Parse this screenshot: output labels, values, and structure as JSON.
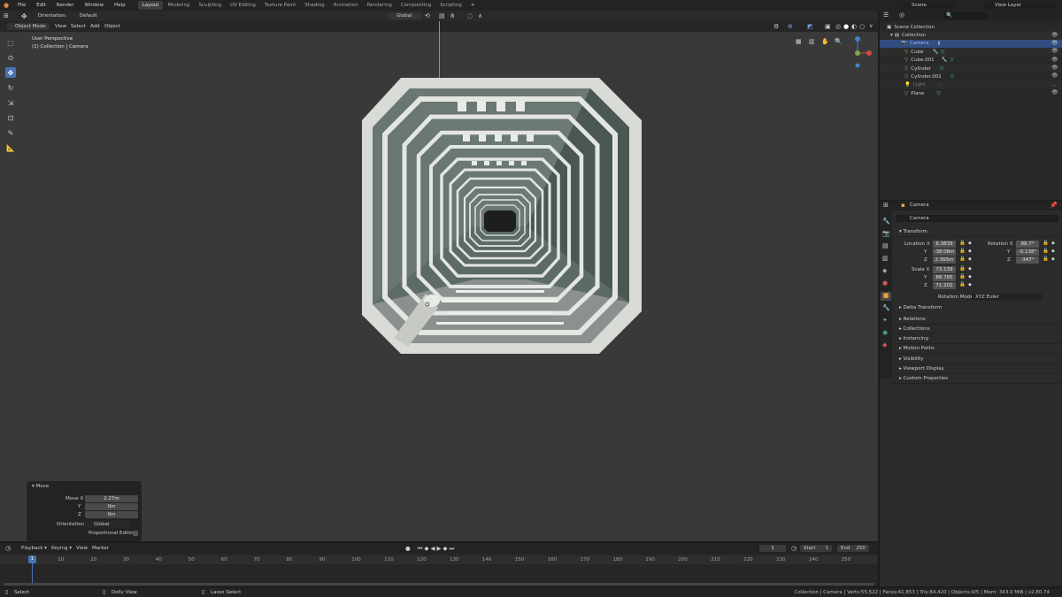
{
  "topbar": {
    "menus": [
      "File",
      "Edit",
      "Render",
      "Window",
      "Help"
    ],
    "workspaces": [
      "Layout",
      "Modeling",
      "Sculpting",
      "UV Editing",
      "Texture Paint",
      "Shading",
      "Animation",
      "Rendering",
      "Compositing",
      "Scripting"
    ],
    "active_workspace": "Layout",
    "scene_label": "Scene",
    "view_layer_label": "View Layer"
  },
  "viewport_header": {
    "orientation_label": "Orientation:",
    "orientation_value": "Default",
    "mode": "Object Mode",
    "menus": [
      "View",
      "Select",
      "Add",
      "Object"
    ],
    "transform_orientation": "Global"
  },
  "viewport": {
    "perspective_label": "User Perspective",
    "context_label": "(1) Collection | Camera"
  },
  "operator_panel": {
    "title": "Move",
    "move_x_label": "Move X",
    "move_x": "2.27m",
    "y_label": "Y",
    "y": "0m",
    "z_label": "Z",
    "z": "0m",
    "orientation_label": "Orientation",
    "orientation_value": "Global",
    "proportional_label": "Proportional Editing"
  },
  "outliner": {
    "root": "Scene Collection",
    "collection": "Collection",
    "items": [
      "Camera",
      "Cube",
      "Cube.001",
      "Cylinder",
      "Cylinder.001",
      "Light",
      "Plane"
    ],
    "selected": "Camera"
  },
  "properties": {
    "object_name": "Camera",
    "datablock_name": "Camera",
    "transform_title": "Transform",
    "location_label": "Location X",
    "loc_x": "6.3839",
    "loc_y": "-38.08m",
    "loc_z": "2.365m",
    "rotation_label": "Rotation X",
    "rot_x": "88.7°",
    "rot_y": "-0.138°",
    "rot_z": "-347°",
    "scale_label": "Scale X",
    "scale_x": "73.139",
    "scale_y": "88.785",
    "scale_z": "71.202",
    "y_label": "Y",
    "z_label": "Z",
    "rotation_mode_label": "Rotation Mode",
    "rotation_mode": "XYZ Euler",
    "delta_transform": "Delta Transform",
    "panels": [
      "Relations",
      "Collections",
      "Instancing",
      "Motion Paths",
      "Visibility",
      "Viewport Display",
      "Custom Properties"
    ]
  },
  "timeline": {
    "menus": [
      "Playback",
      "Keying",
      "View",
      "Marker"
    ],
    "current_frame": "1",
    "start_label": "Start",
    "start": "1",
    "end_label": "End",
    "end": "250",
    "ticks": [
      "1",
      "10",
      "20",
      "30",
      "40",
      "50",
      "60",
      "70",
      "80",
      "90",
      "100",
      "110",
      "120",
      "130",
      "140",
      "150",
      "160",
      "170",
      "180",
      "190",
      "200",
      "210",
      "220",
      "230",
      "240",
      "250"
    ]
  },
  "statusbar": {
    "select": "Select",
    "dolly": "Dolly View",
    "lasso": "Lasso Select",
    "stats": "Collection | Camera | Verts:55,522 | Faces:41,853 | Tris:84,420 | Objects:0/5 | Mem: 343.0 MiB | v2.80.74"
  },
  "colors": {
    "accent": "#4772b3",
    "background": "#1d1d1d",
    "viewport": "#393939",
    "tunnel": "#d8dad6",
    "tunnel_shadow": "#4e5955"
  }
}
